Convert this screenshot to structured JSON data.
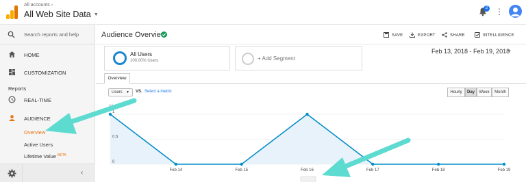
{
  "header": {
    "breadcrumb": "All accounts",
    "account_title": "All Web Site Data",
    "notification_count": "2"
  },
  "sidebar": {
    "search_placeholder": "Search reports and help",
    "items": [
      {
        "label": "HOME",
        "icon": "home-icon"
      },
      {
        "label": "CUSTOMIZATION",
        "icon": "dashboard-icon"
      }
    ],
    "reports_label": "Reports",
    "realtime_label": "REAL-TIME",
    "audience_label": "AUDIENCE",
    "audience_children": [
      {
        "label": "Overview",
        "active": true
      },
      {
        "label": "Active Users",
        "active": false
      },
      {
        "label": "Lifetime Value",
        "badge": "BETA",
        "active": false
      }
    ]
  },
  "main": {
    "title": "Audience Overview",
    "toolbar": {
      "save": "SAVE",
      "export": "EXPORT",
      "share": "SHARE",
      "intelligence": "INTELLIGENCE"
    },
    "segment": {
      "name": "All Users",
      "sub": "100.00% Users"
    },
    "add_segment": "+ Add Segment",
    "date_range": "Feb 13, 2018 - Feb 19, 2018",
    "tab": "Overview",
    "metric": "Users",
    "vs": "VS.",
    "select_metric": "Select a metric",
    "granularity": [
      {
        "label": "Hourly",
        "active": false
      },
      {
        "label": "Day",
        "active": true
      },
      {
        "label": "Week",
        "active": false
      },
      {
        "label": "Month",
        "active": false
      }
    ]
  },
  "chart_data": {
    "type": "area",
    "series": [
      {
        "name": "Users",
        "values": [
          1,
          0,
          0,
          1,
          0,
          0,
          0
        ]
      }
    ],
    "categories": [
      "Feb 13",
      "Feb 14",
      "Feb 15",
      "Feb 16",
      "Feb 17",
      "Feb 18",
      "Feb 19"
    ],
    "x_tick_labels": [
      "",
      "Feb 14",
      "Feb 15",
      "Feb 16",
      "Feb 17",
      "Feb 18",
      "Feb 19"
    ],
    "y_ticks": [
      "0",
      "0.5",
      "1"
    ],
    "ylabel": "Users",
    "ylim": [
      0,
      1
    ],
    "color": "#058dc7",
    "fill": "#e8f2fb"
  },
  "colors": {
    "accent_orange": "#e8710a",
    "arrow_teal": "#5ddbd0",
    "link_blue": "#1a73e8"
  }
}
